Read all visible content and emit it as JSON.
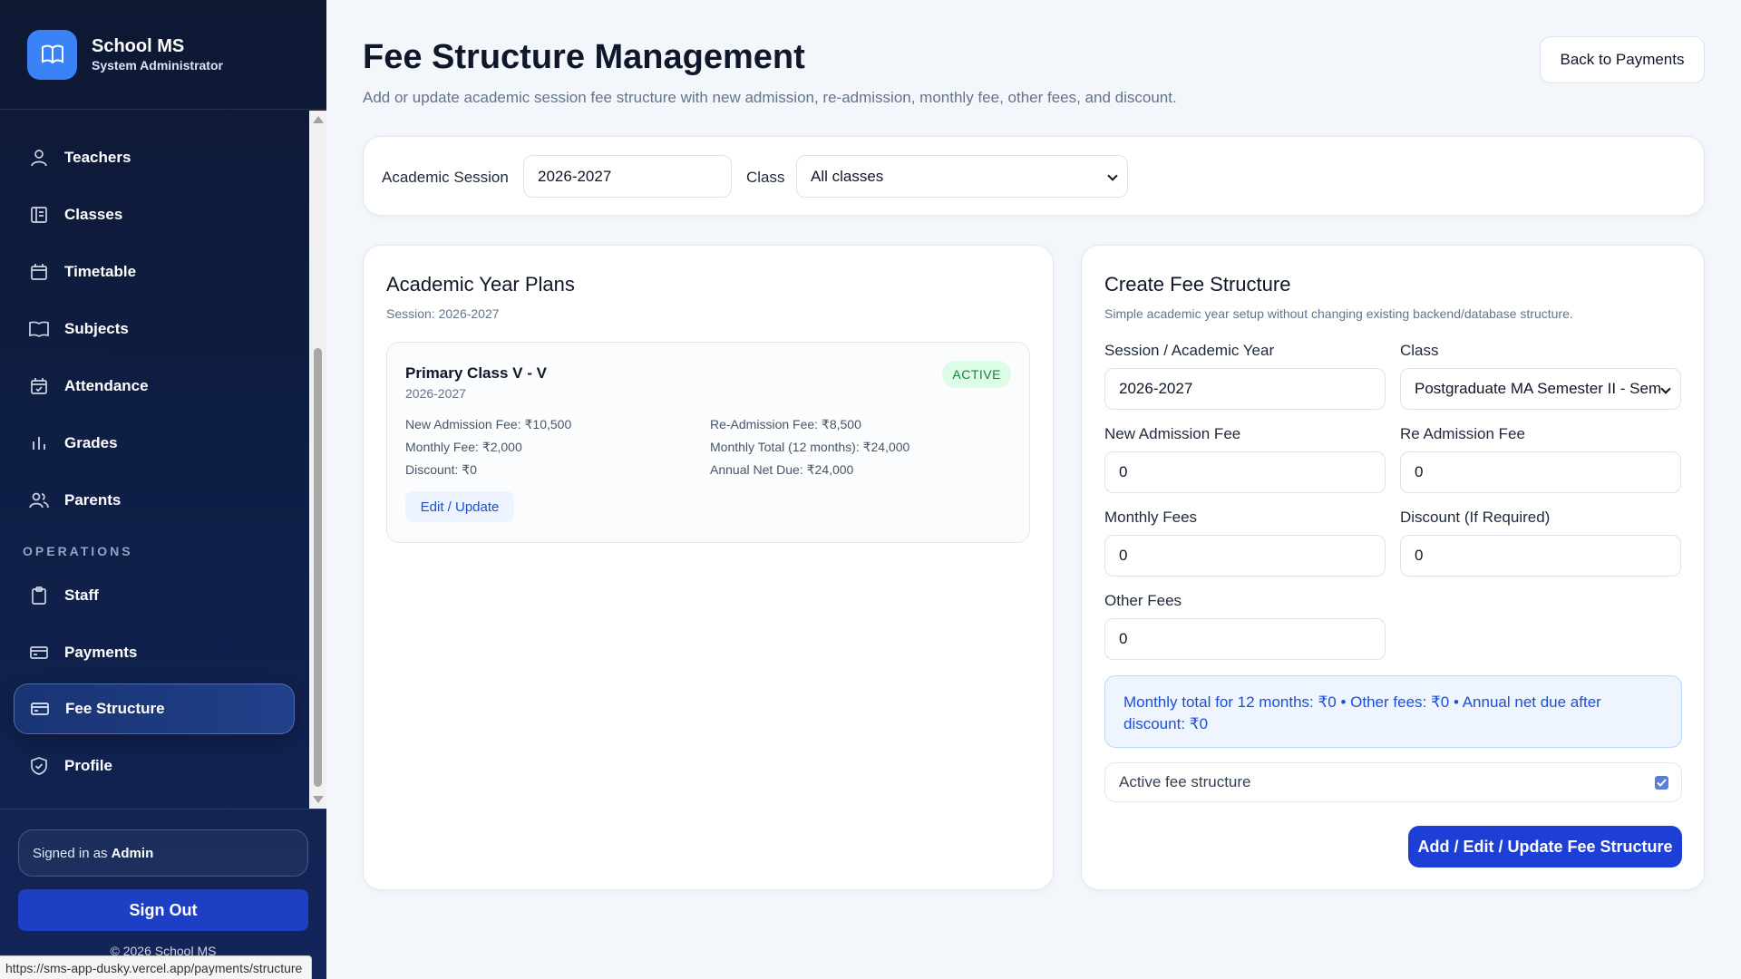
{
  "brand": {
    "name": "School MS",
    "role": "System Administrator"
  },
  "nav": {
    "items": [
      {
        "label": "Teachers",
        "icon": "user-icon"
      },
      {
        "label": "Classes",
        "icon": "classes-icon"
      },
      {
        "label": "Timetable",
        "icon": "calendar-icon"
      },
      {
        "label": "Subjects",
        "icon": "book-icon"
      },
      {
        "label": "Attendance",
        "icon": "calendar-check-icon"
      },
      {
        "label": "Grades",
        "icon": "bar-chart-icon"
      },
      {
        "label": "Parents",
        "icon": "users-icon"
      }
    ],
    "section_operations": "OPERATIONS",
    "ops_items": [
      {
        "label": "Staff",
        "icon": "clipboard-icon"
      },
      {
        "label": "Payments",
        "icon": "card-icon"
      },
      {
        "label": "Fee Structure",
        "icon": "card-icon",
        "active": true
      },
      {
        "label": "Profile",
        "icon": "shield-icon"
      }
    ]
  },
  "footer": {
    "signed_in_prefix": "Signed in as",
    "signed_in_user": "Admin",
    "sign_out": "Sign Out",
    "copyright": "© 2026 School MS"
  },
  "status_url": "https://sms-app-dusky.vercel.app/payments/structure",
  "header": {
    "title": "Fee Structure Management",
    "subtitle": "Add or update academic session fee structure with new admission, re-admission, monthly fee, other fees, and discount.",
    "back_button": "Back to Payments"
  },
  "filters": {
    "session_label": "Academic Session",
    "session_value": "2026-2027",
    "class_label": "Class",
    "class_value": "All classes"
  },
  "plans": {
    "title": "Academic Year Plans",
    "session": "Session: 2026-2027",
    "items": [
      {
        "name": "Primary Class V - V",
        "year": "2026-2027",
        "badge": "ACTIVE",
        "new_admission": "New Admission Fee: ₹10,500",
        "re_admission": "Re-Admission Fee: ₹8,500",
        "monthly_fee": "Monthly Fee: ₹2,000",
        "monthly_total": "Monthly Total (12 months): ₹24,000",
        "discount": "Discount: ₹0",
        "annual_net": "Annual Net Due: ₹24,000",
        "edit_label": "Edit / Update"
      }
    ]
  },
  "form": {
    "title": "Create Fee Structure",
    "subtitle": "Simple academic year setup without changing existing backend/database structure.",
    "session_label": "Session / Academic Year",
    "session_value": "2026-2027",
    "class_label": "Class",
    "class_value": "Postgraduate MA Semester II - Sem",
    "new_admission_label": "New Admission Fee",
    "new_admission_value": "0",
    "re_admission_label": "Re Admission Fee",
    "re_admission_value": "0",
    "monthly_label": "Monthly Fees",
    "monthly_value": "0",
    "discount_label": "Discount (If Required)",
    "discount_value": "0",
    "other_label": "Other Fees",
    "other_value": "0",
    "summary": "Monthly total for 12 months: ₹0 • Other fees: ₹0 • Annual net due after discount: ₹0",
    "active_label": "Active fee structure",
    "active_checked": true,
    "submit": "Add / Edit / Update Fee Structure"
  },
  "colors": {
    "sidebar_bg": "#0d1833",
    "accent": "#1d3fd6",
    "badge_bg": "#dcfce7",
    "badge_text": "#15803d"
  }
}
